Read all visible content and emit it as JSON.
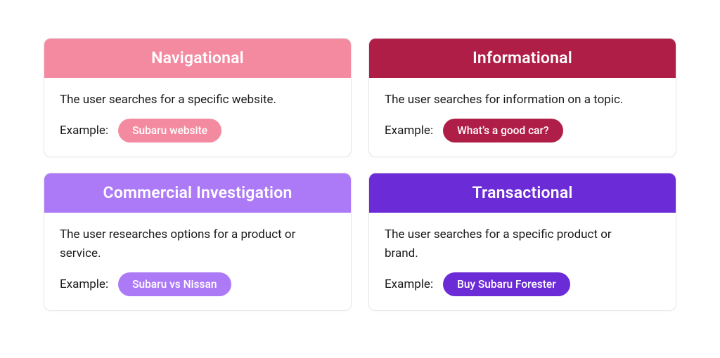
{
  "cards": [
    {
      "key": "navigational",
      "title": "Navigational",
      "description": "The user searches for a specific website.",
      "example_label": "Example:",
      "example_pill": "Subaru website",
      "header_bg": "#f48aa0",
      "pill_bg": "#f48aa0"
    },
    {
      "key": "informational",
      "title": "Informational",
      "description": "The user searches for information on a topic.",
      "example_label": "Example:",
      "example_pill": "What’s a good car?",
      "header_bg": "#af1e47",
      "pill_bg": "#af1e47"
    },
    {
      "key": "commercial-investigation",
      "title": "Commercial Investigation",
      "description": "The user researches options for a product or service.",
      "example_label": "Example:",
      "example_pill": "Subaru vs Nissan",
      "header_bg": "#ad7af7",
      "pill_bg": "#ad7af7"
    },
    {
      "key": "transactional",
      "title": "Transactional",
      "description": "The user searches for a specific product or brand.",
      "example_label": "Example:",
      "example_pill": "Buy Subaru Forester",
      "header_bg": "#6b2bd6",
      "pill_bg": "#6b2bd6"
    }
  ]
}
